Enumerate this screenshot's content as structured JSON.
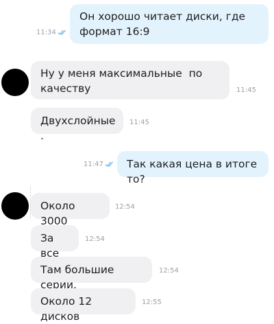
{
  "messages": [
    {
      "direction": "outgoing",
      "text": "Он хорошо читает диски, где формат 16:9",
      "time": "11:34",
      "read_icon": "double-check-icon"
    },
    {
      "direction": "incoming",
      "text": "Ну у меня максимальные  по качеству",
      "time": "11:45"
    },
    {
      "direction": "incoming",
      "text": "Двухслойные .",
      "time": "11:45"
    },
    {
      "direction": "outgoing",
      "text": "Так какая цена в итоге то?",
      "time": "11:47",
      "read_icon": "double-check-icon"
    },
    {
      "direction": "incoming",
      "text": "Около 3000",
      "time": "12:54"
    },
    {
      "direction": "incoming",
      "text": "За все",
      "time": "12:54"
    },
    {
      "direction": "incoming",
      "text": "Там большие серии.",
      "time": "12:54"
    },
    {
      "direction": "incoming",
      "text": "Около 12 дисков",
      "time": "12:55"
    }
  ],
  "colors": {
    "outgoing_bubble": "#e3f3fd",
    "incoming_bubble": "#f0f0f2",
    "avatar": "#000000",
    "timestamp": "#9a9ea6",
    "read_check": "#5aaee8"
  }
}
